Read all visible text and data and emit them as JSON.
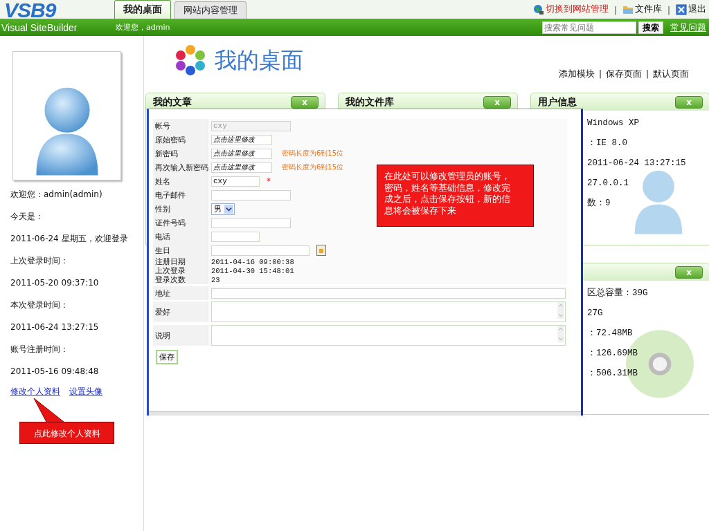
{
  "header": {
    "logo": "VSB9",
    "logo_subtitle": "Visual SiteBuilder",
    "tabs": [
      {
        "label": "我的桌面",
        "selected": true
      },
      {
        "label": "网站内容管理",
        "selected": false
      }
    ],
    "welcome": "欢迎您，admin",
    "top_links": [
      {
        "kind": "globe",
        "label": "切换到网站管理",
        "highlighted": true
      },
      {
        "kind": "folder",
        "label": "文件库",
        "highlighted": false
      },
      {
        "kind": "exit",
        "label": "退出",
        "highlighted": false
      }
    ],
    "top_separators": [
      "|",
      "|"
    ],
    "search": {
      "placeholder": "搜索常见问题",
      "button": "搜索",
      "help_link": "常见问题"
    }
  },
  "sidebar": {
    "lines": [
      "欢迎您：admin(admin)",
      "今天是：",
      "2011-06-24 星期五，欢迎登录",
      "上次登录时间：",
      "2011-05-20 09:37:10",
      "本次登录时间：",
      "2011-06-24 13:27:15",
      "账号注册时间：",
      "2011-05-16 09:48:48"
    ],
    "links": [
      "修改个人资料",
      "设置头像"
    ],
    "callout": "点此修改个人资料"
  },
  "desktop": {
    "title": "我的桌面",
    "actions": [
      "添加模块",
      "保存页面",
      "默认页面"
    ],
    "action_separators": [
      "|",
      "|"
    ]
  },
  "columns": [
    [
      {
        "kind": "plain",
        "title": "我的文章",
        "close": "x"
      }
    ],
    [
      {
        "kind": "plain",
        "title": "我的文件库",
        "close": "x"
      }
    ],
    [
      {
        "kind": "user",
        "title": "用户信息",
        "close": "x",
        "lines": [
          "Windows XP",
          "：IE 8.0",
          "2011-06-24 13:27:15",
          "27.0.0.1",
          "数：9"
        ]
      },
      {
        "kind": "disk",
        "close": "x",
        "lines": [
          "区总容量：39G",
          "27G",
          "：72.48MB",
          "：126.69MB",
          "：506.31MB"
        ]
      }
    ]
  ],
  "dialog": {
    "fields": [
      {
        "kind": "text",
        "label": "帐号",
        "value": "cxy",
        "disabled": true
      },
      {
        "kind": "password",
        "label": "原始密码",
        "value": "点击这里修改",
        "disabled": false
      },
      {
        "kind": "password",
        "label": "新密码",
        "value": "点击这里修改",
        "hint": "密码长度为6到15位",
        "disabled": false
      },
      {
        "kind": "password",
        "label": "再次输入新密码",
        "value": "点击这里修改",
        "hint": "密码长度为6到15位",
        "disabled": false
      },
      {
        "kind": "short",
        "label": "姓名",
        "value": "cxy",
        "required": "*",
        "disabled": false
      },
      {
        "kind": "text",
        "label": "电子邮件",
        "disabled": false
      },
      {
        "kind": "select",
        "label": "性别",
        "value": "男",
        "disabled": false
      },
      {
        "kind": "text",
        "label": "证件号码",
        "disabled": false
      },
      {
        "kind": "short",
        "label": "电话",
        "disabled": false
      },
      {
        "kind": "date",
        "label": "生日",
        "disabled": false
      },
      {
        "kind": "static",
        "label": "注册日期",
        "value": "2011-04-16 09:00:38",
        "disabled": false
      },
      {
        "kind": "static",
        "label": "上次登录",
        "value": "2011-04-30 15:48:01",
        "disabled": false
      },
      {
        "kind": "static",
        "label": "登录次数",
        "value": "23",
        "disabled": false
      },
      {
        "kind": "line",
        "label": "地址",
        "disabled": false
      },
      {
        "kind": "area",
        "label": "爱好",
        "disabled": false
      },
      {
        "kind": "area",
        "label": "说明",
        "disabled": false
      }
    ],
    "save": "保存",
    "callout": "在此处可以修改管理员的账号，密码，姓名等基础信息，修改完成之后，点击保存按钮，新的信息将会被保存下来"
  }
}
